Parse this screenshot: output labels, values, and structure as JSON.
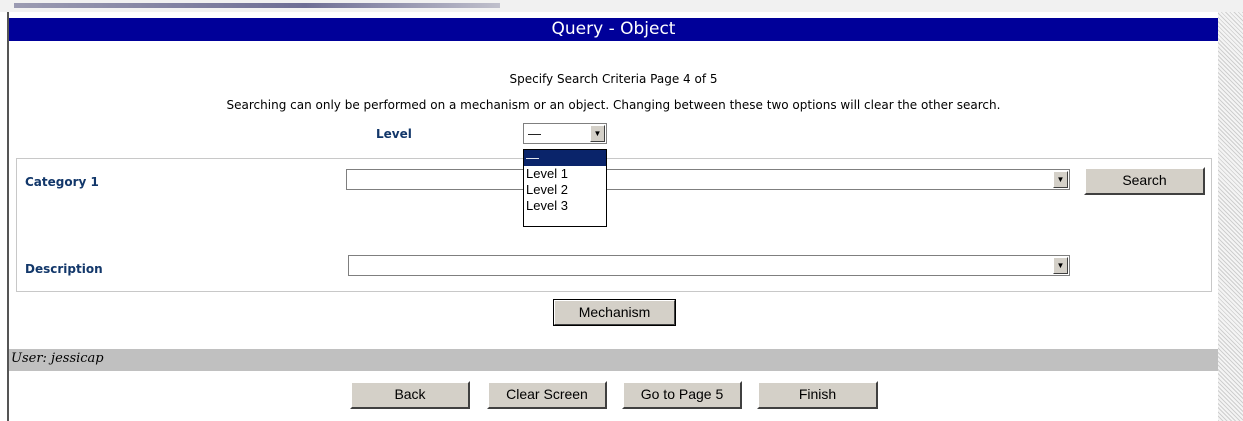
{
  "header": {
    "title": "Query - Object"
  },
  "instructions": {
    "page_info": "Specify Search Criteria Page 4 of 5",
    "note": "Searching can only be performed on a mechanism or an object. Changing between these two options will clear the other search."
  },
  "level": {
    "label": "Level",
    "selected": "—",
    "options": [
      "—",
      "Level 1",
      "Level 2",
      "Level 3"
    ]
  },
  "category1": {
    "label": "Category 1",
    "value": ""
  },
  "description": {
    "label": "Description",
    "value": ""
  },
  "buttons": {
    "search": "Search",
    "mechanism": "Mechanism",
    "back": "Back",
    "clear_screen": "Clear Screen",
    "go_to_page": "Go to Page 5",
    "finish": "Finish"
  },
  "footer": {
    "user": "User: jessicap"
  },
  "icons": {
    "dropdown_arrow": "chevron-down-icon"
  },
  "colors": {
    "title_bar": "#000099",
    "label_text": "#12376a",
    "selection": "#0a246a",
    "user_bar": "#c0c0c0"
  }
}
